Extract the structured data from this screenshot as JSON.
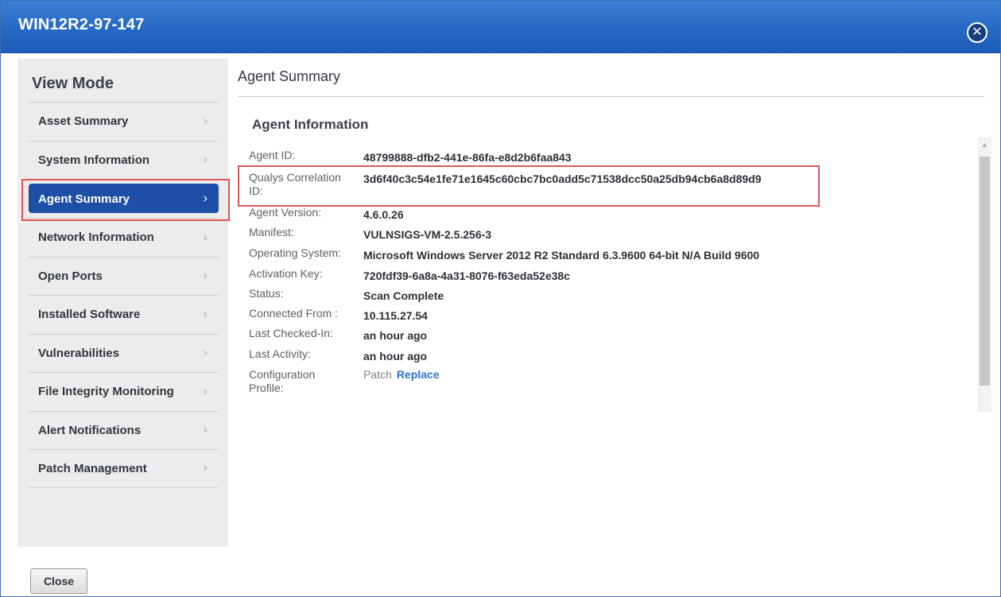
{
  "window": {
    "title": "WIN12R2-97-147"
  },
  "sidebar": {
    "title": "View Mode",
    "items": [
      {
        "label": "Asset Summary"
      },
      {
        "label": "System Information"
      },
      {
        "label": "Agent Summary",
        "active": true
      },
      {
        "label": "Network Information"
      },
      {
        "label": "Open Ports"
      },
      {
        "label": "Installed Software"
      },
      {
        "label": "Vulnerabilities"
      },
      {
        "label": "File Integrity Monitoring"
      },
      {
        "label": "Alert Notifications"
      },
      {
        "label": "Patch Management"
      }
    ]
  },
  "main": {
    "title": "Agent Summary",
    "section_title": "Agent Information",
    "fields": {
      "agent_id": {
        "label": "Agent ID:",
        "value": "48799888-dfb2-441e-86fa-e8d2b6faa843"
      },
      "correlation_id": {
        "label": "Qualys Correlation ID:",
        "value": "3d6f40c3c54e1fe71e1645c60cbc7bc0add5c71538dcc50a25db94cb6a8d89d9"
      },
      "agent_version": {
        "label": "Agent Version:",
        "value": "4.6.0.26"
      },
      "manifest": {
        "label": "Manifest:",
        "value": "VULNSIGS-VM-2.5.256-3"
      },
      "os": {
        "label": "Operating System:",
        "value": "Microsoft Windows Server 2012 R2 Standard 6.3.9600 64-bit N/A Build 9600"
      },
      "activation_key": {
        "label": "Activation Key:",
        "value": "720fdf39-6a8a-4a31-8076-f63eda52e38c"
      },
      "status": {
        "label": "Status:",
        "value": "Scan Complete"
      },
      "connected_from": {
        "label": "Connected From :",
        "value": "10.115.27.54"
      },
      "last_checked_in": {
        "label": "Last Checked-In:",
        "value": "an hour ago"
      },
      "last_activity": {
        "label": "Last Activity:",
        "value": "an hour ago"
      },
      "config_profile": {
        "label": "Configuration Profile:",
        "value": "Patch",
        "link": "Replace"
      }
    }
  },
  "footer": {
    "close_label": "Close"
  },
  "colors": {
    "titlebar": "#2567c4",
    "active_nav": "#1e4fa6",
    "highlight_border": "#e05555",
    "link": "#2a72d4"
  },
  "icons": {
    "close": "close-icon",
    "chevron": "chevron-right-icon",
    "scroll_up": "arrow-up-icon"
  }
}
